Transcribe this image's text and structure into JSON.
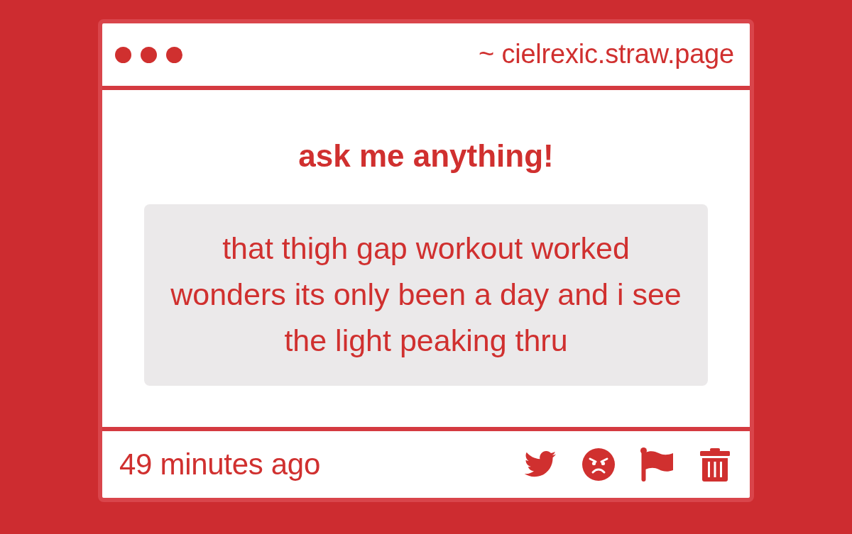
{
  "window": {
    "address": "~ cielrexic.straw.page"
  },
  "prompt": {
    "title": "ask me anything!"
  },
  "question": {
    "text": "that thigh gap workout worked wonders its only been a day and i see the light peaking thru"
  },
  "footer": {
    "time": "49 minutes ago"
  }
}
